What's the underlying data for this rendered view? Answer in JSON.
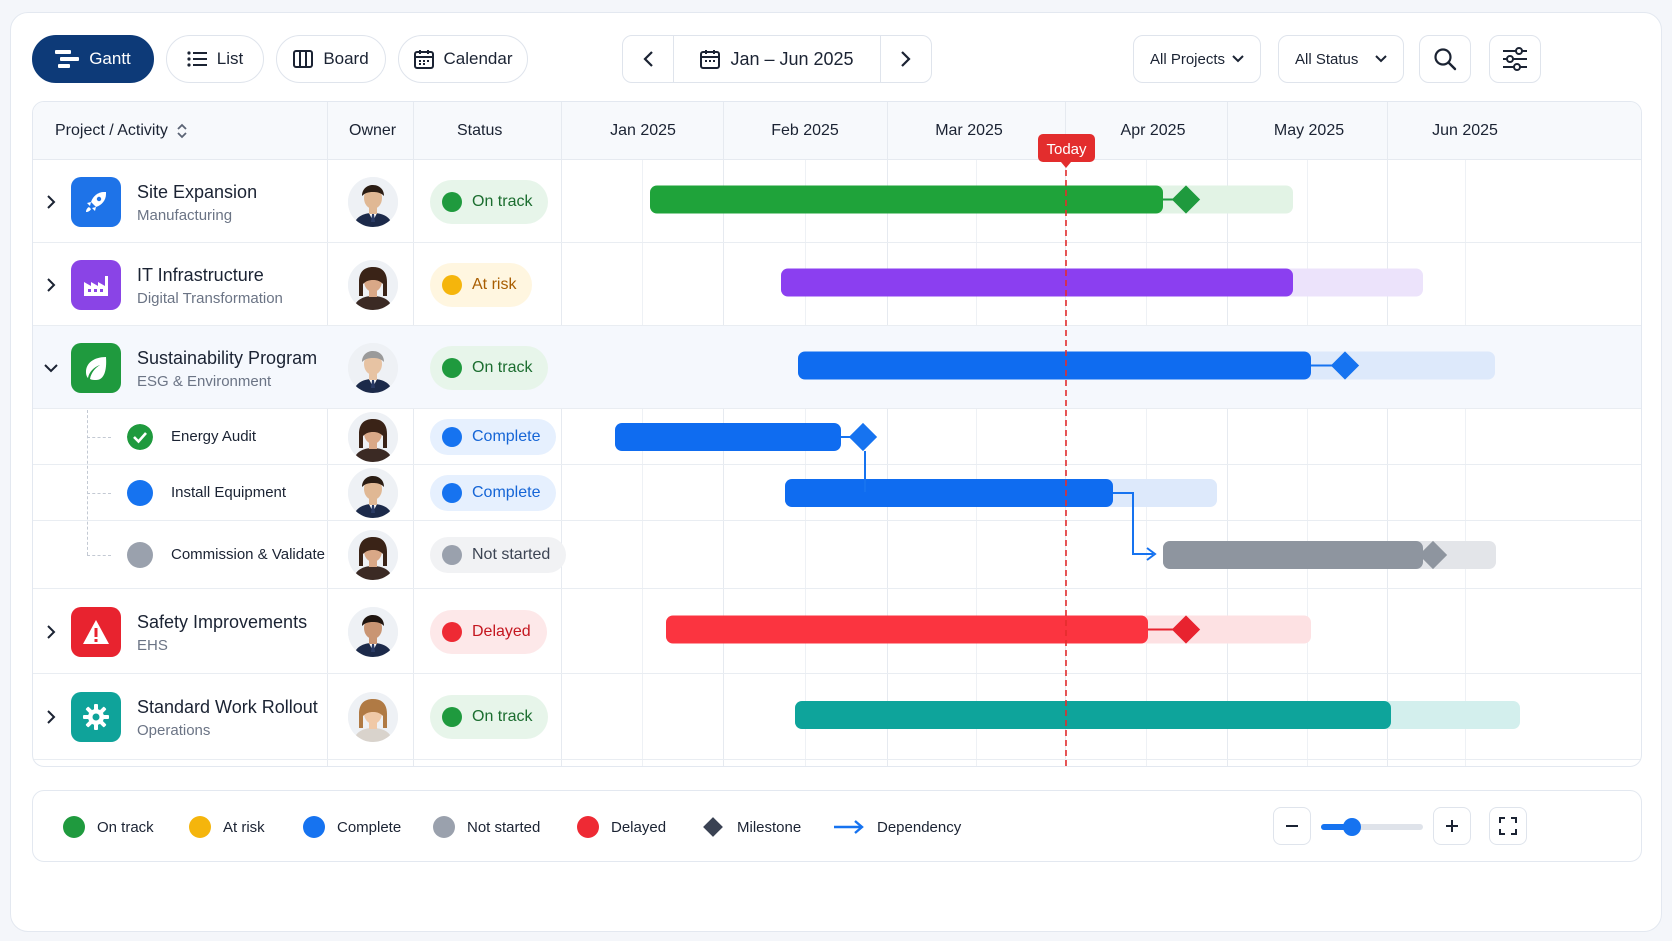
{
  "toolbar": {
    "views": [
      {
        "label": "Gantt",
        "icon": "gantt-icon",
        "active": true
      },
      {
        "label": "List",
        "icon": "list-icon",
        "active": false
      },
      {
        "label": "Board",
        "icon": "board-icon",
        "active": false
      },
      {
        "label": "Calendar",
        "icon": "calendar-icon",
        "active": false
      }
    ],
    "date_range": "Jan – Jun 2025",
    "projects_filter": "All Projects",
    "status_filter": "All Status"
  },
  "columns": {
    "project": "Project / Activity",
    "owner": "Owner",
    "status": "Status"
  },
  "months": [
    "Jan 2025",
    "Feb 2025",
    "Mar 2025",
    "Apr 2025",
    "May 2025",
    "Jun 2025"
  ],
  "today_label": "Today",
  "rows": [
    {
      "name": "Site Expansion",
      "sub": "Manufacturing",
      "status": "On track",
      "expanded": false,
      "icon": "rocket-icon",
      "color": "#1e73e8"
    },
    {
      "name": "IT Infrastructure",
      "sub": "Digital Transformation",
      "status": "At risk",
      "expanded": false,
      "icon": "factory-icon",
      "color": "#8a44e6"
    },
    {
      "name": "Sustainability Program",
      "sub": "ESG & Environment",
      "status": "On track",
      "expanded": true,
      "icon": "leaf-icon",
      "color": "#1f9a3e"
    },
    {
      "name": "Energy Audit",
      "status": "Complete",
      "icon": "check-circle-icon"
    },
    {
      "name": "Install Equipment",
      "status": "Complete"
    },
    {
      "name": "Commission & Validate",
      "status": "Not started"
    },
    {
      "name": "Safety Improvements",
      "sub": "EHS",
      "status": "Delayed",
      "expanded": false,
      "icon": "warning-icon",
      "color": "#e8232f"
    },
    {
      "name": "Standard Work Rollout",
      "sub": "Operations",
      "status": "On track",
      "expanded": false,
      "icon": "gear-icon",
      "color": "#0fa39a"
    }
  ],
  "legend": [
    {
      "label": "On track",
      "color": "#1f9a3e"
    },
    {
      "label": "At risk",
      "color": "#f5b50c"
    },
    {
      "label": "Complete",
      "color": "#1673f0"
    },
    {
      "label": "Not started",
      "color": "#9aa1ad"
    },
    {
      "label": "Delayed",
      "color": "#ee2a34"
    },
    {
      "label": "Milestone",
      "color": "#3a4253"
    },
    {
      "label": "Dependency",
      "color": "#1673f0"
    }
  ],
  "colors": {
    "primary": "#0d3a78",
    "on_track": "#1fa33a",
    "at_risk": "#8b3ff0",
    "complete": "#0f6cf0",
    "not_started": "#8e959f",
    "delayed": "#fb3440",
    "teal": "#0ea49b",
    "today": "#e32d2d"
  }
}
